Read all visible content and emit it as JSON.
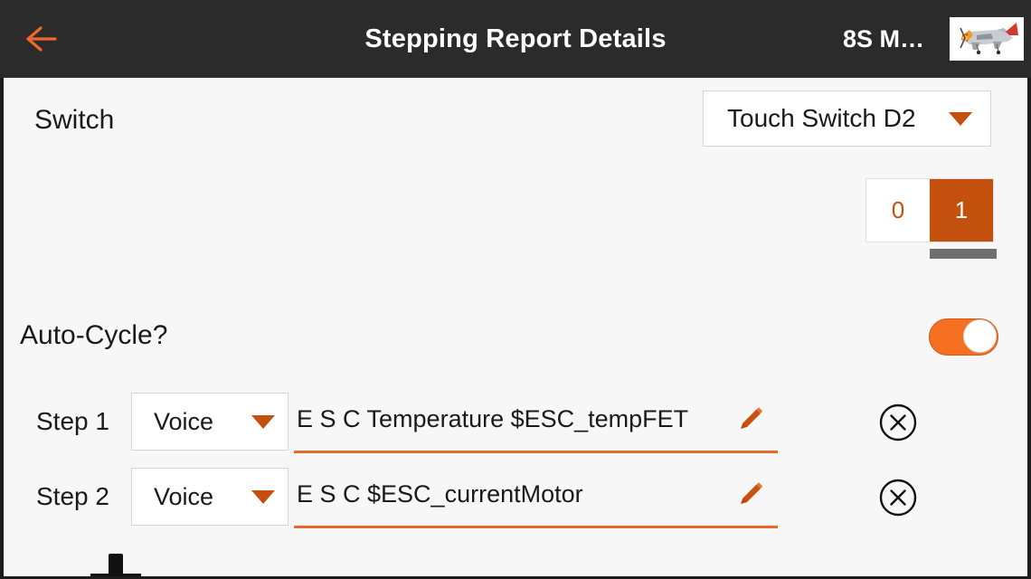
{
  "titlebar": {
    "back_icon": "arrow-left-icon",
    "title": "Stepping Report Details",
    "model_name": "8S M…",
    "model_thumb_icon": "airplane-photo"
  },
  "switch_row": {
    "label": "Switch",
    "dropdown_value": "Touch Switch D2",
    "dropdown_caret_icon": "chevron-down-icon"
  },
  "segmented": {
    "options": [
      {
        "label": "0",
        "selected": false
      },
      {
        "label": "1",
        "selected": true
      }
    ]
  },
  "auto_cycle": {
    "label": "Auto-Cycle?",
    "enabled": true,
    "state_text": "on"
  },
  "steps": [
    {
      "label": "Step 1",
      "type": "Voice",
      "text": "E S C Temperature $ESC_tempFET",
      "edit_icon": "pencil-icon",
      "delete_icon": "close-circle-icon"
    },
    {
      "label": "Step 2",
      "type": "Voice",
      "text": "E S C $ESC_currentMotor",
      "edit_icon": "pencil-icon",
      "delete_icon": "close-circle-icon"
    }
  ],
  "colors": {
    "titlebar_bg": "#2b2b2b",
    "accent_orange": "#e8692b",
    "accent_dark_orange": "#c4500e",
    "toggle_on": "#f57020",
    "content_bg": "#f7f7f7",
    "text_primary": "#1a1a1a",
    "scroll_thumb": "#707070"
  }
}
